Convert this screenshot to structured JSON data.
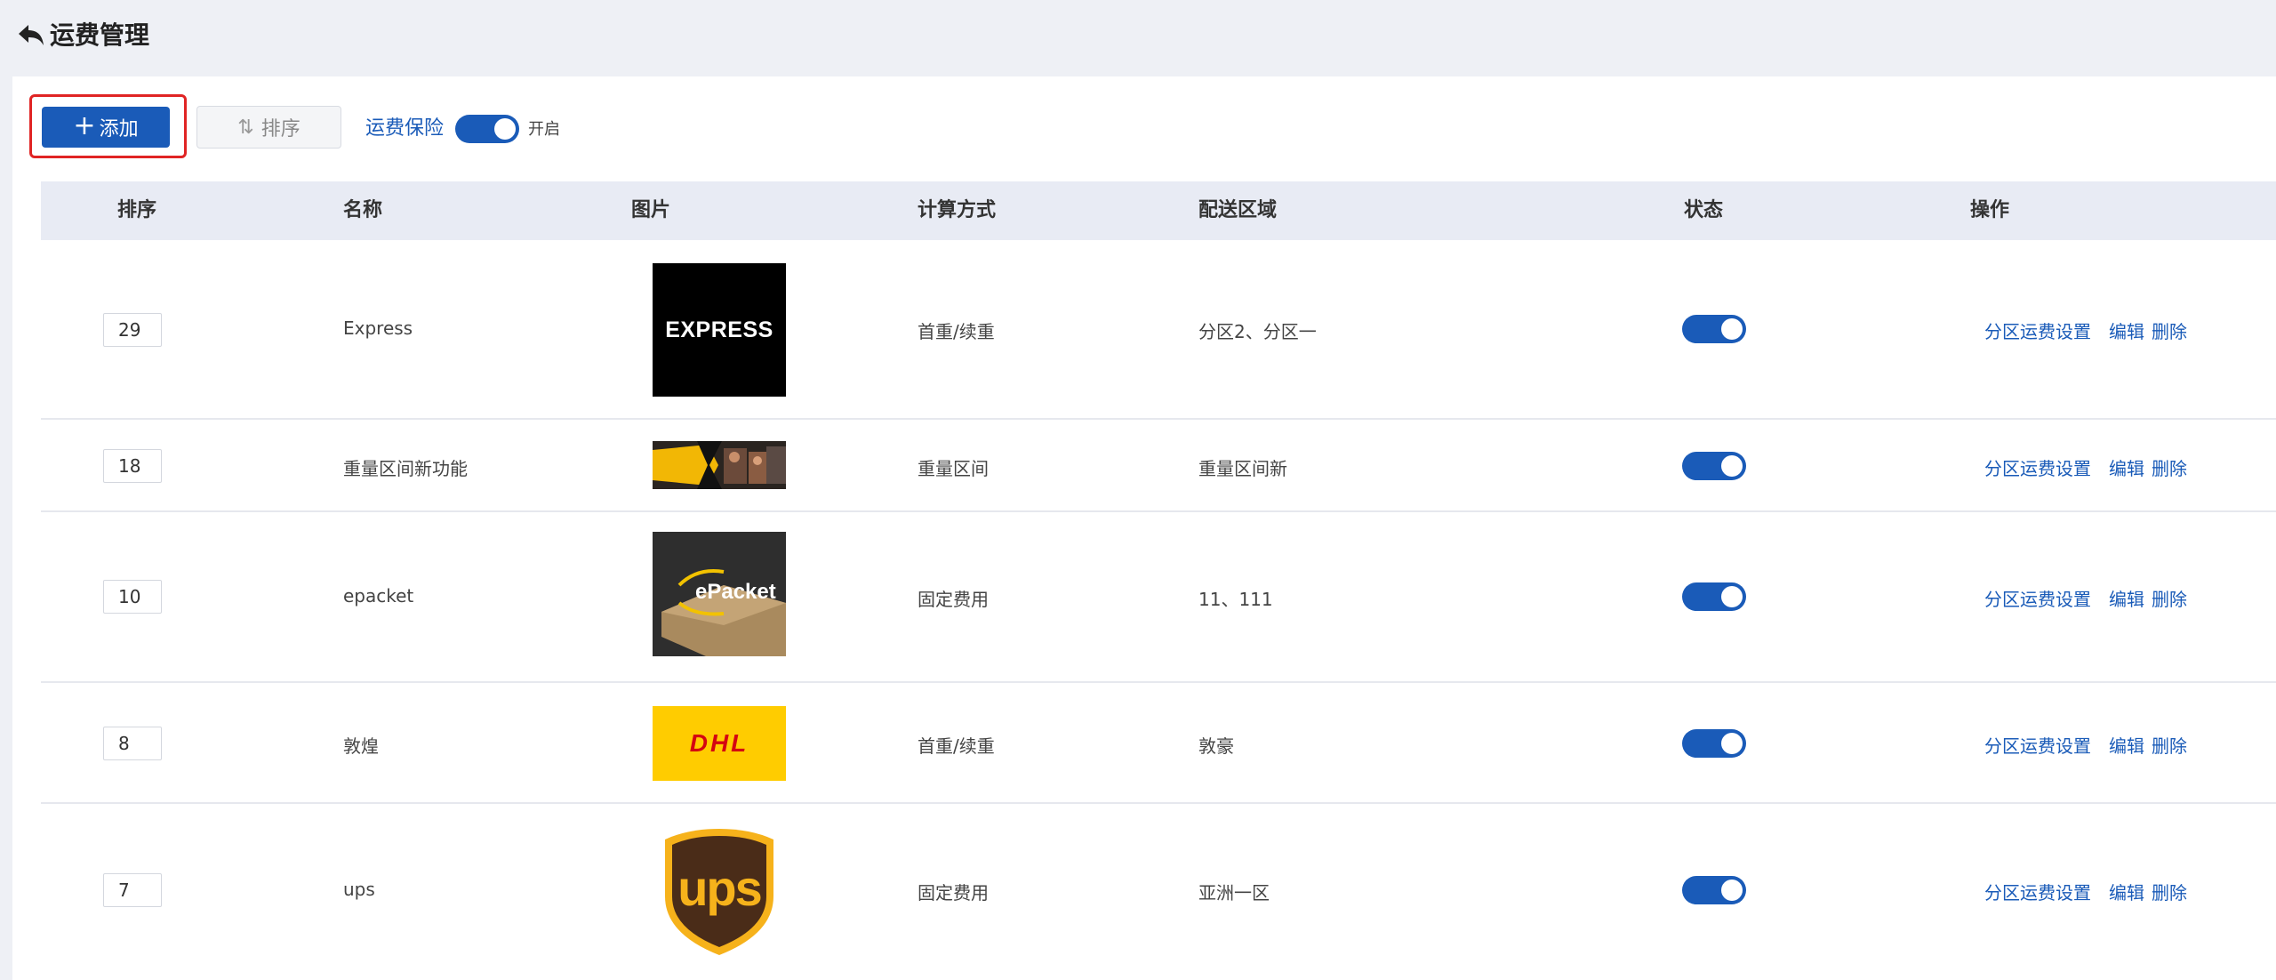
{
  "header": {
    "title": "运费管理"
  },
  "toolbar": {
    "add_label": "添加",
    "sort_label": "排序",
    "insurance_label": "运费保险",
    "insurance_state": "开启"
  },
  "table": {
    "columns": [
      "排序",
      "名称",
      "图片",
      "计算方式",
      "配送区域",
      "状态",
      "操作"
    ],
    "rows": [
      {
        "order": "29",
        "name": "Express",
        "image": "EXPRESS",
        "method": "首重/续重",
        "zone": "分区2、分区一",
        "status": "on"
      },
      {
        "order": "18",
        "name": "重量区间新功能",
        "image": "banner",
        "method": "重量区间",
        "zone": "重量区间新",
        "status": "on"
      },
      {
        "order": "10",
        "name": "epacket",
        "image": "ePacket",
        "method": "固定费用",
        "zone": "11、111",
        "status": "on"
      },
      {
        "order": "8",
        "name": "敦煌",
        "image": "DHL",
        "method": "首重/续重",
        "zone": "敦豪",
        "status": "on"
      },
      {
        "order": "7",
        "name": "ups",
        "image": "ups",
        "method": "固定费用",
        "zone": "亚洲一区",
        "status": "on"
      }
    ],
    "actions": {
      "zone": "分区运费设置",
      "edit": "编辑",
      "delete": "删除"
    }
  },
  "colors": {
    "accent": "#1a5bb8",
    "highlight": "#e02424",
    "dhl_yellow": "#ffcc00",
    "dhl_red": "#d40511",
    "ups_brown": "#4a2c18",
    "ups_gold": "#f6b21b"
  }
}
